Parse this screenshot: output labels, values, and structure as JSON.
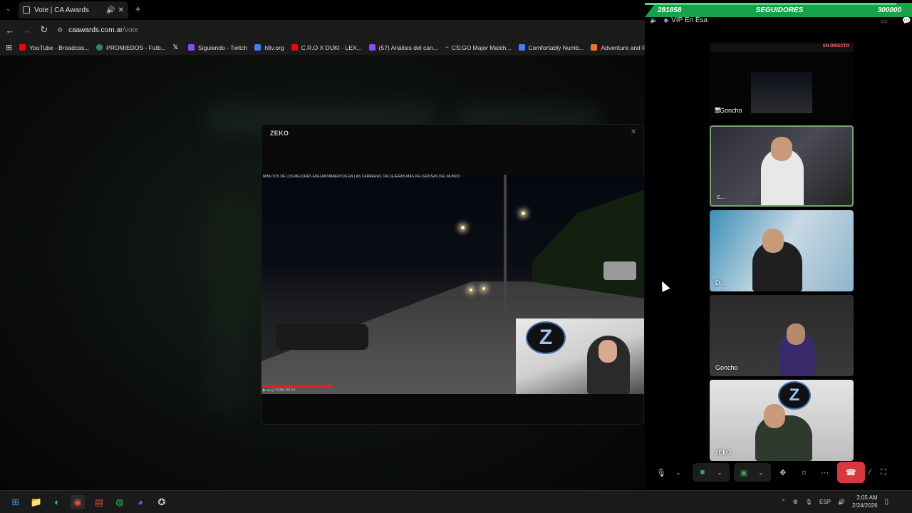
{
  "browser": {
    "tab": {
      "title": "Vote | CA Awards"
    },
    "address": {
      "domain": "caawards.com.ar",
      "path": "/vote"
    },
    "bookmarks": [
      {
        "label": "YouTube - Broadcas...",
        "color": "#ff0000"
      },
      {
        "label": "PROMIEDOS - Futb...",
        "color": "#2e8b57"
      },
      {
        "label": "",
        "color": "#ffffff"
      },
      {
        "label": "Siguiendo - Twitch",
        "color": "#9146ff"
      },
      {
        "label": "hltv.org",
        "color": "#3b82f6"
      },
      {
        "label": "C.R.O X DUKI - LEX...",
        "color": "#ff0000"
      },
      {
        "label": "(57) Análisis del can...",
        "color": "#9146ff"
      },
      {
        "label": "CS:GO Major Match...",
        "color": "#999999"
      },
      {
        "label": "Comfortably Numb...",
        "color": "#3b82f6"
      },
      {
        "label": "Adventure and RPG",
        "color": "#f97316"
      }
    ]
  },
  "modal": {
    "title": "ZEKO",
    "video_caption": "MINUTOS DE LOS MEJORES ADELANTAMIENTOS EN LAS CARRERAS CALLEJERAS MAS PELIGROSAS DEL MUNDO",
    "progress": 0.27,
    "time": "5:33 / 26:14"
  },
  "panel": {
    "followers": {
      "current": "281858",
      "label": "SEGUIDORES",
      "goal": "300000",
      "progress": 0.94
    },
    "channel": "VIP En Esa",
    "live_badge": "EN DIRECTO",
    "tiles": [
      {
        "name": "Goncho",
        "stream": true
      },
      {
        "name": "c...",
        "active": true
      },
      {
        "name": "D..."
      },
      {
        "name": "Goncho"
      },
      {
        "name": "zEkO"
      }
    ]
  },
  "taskbar": {
    "lang": "ESP",
    "time": "3:05 AM",
    "date": "2/24/2026"
  }
}
